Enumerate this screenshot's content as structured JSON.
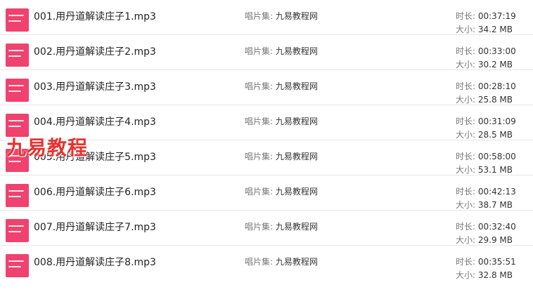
{
  "labels": {
    "album": "唱片集: ",
    "duration": "时长: ",
    "size": "大小: "
  },
  "watermark": "九易教程",
  "tracks": [
    {
      "title": "001.用丹道解读庄子1.mp3",
      "album": "九易教程网",
      "duration": "00:37:19",
      "size": "34.2 MB"
    },
    {
      "title": "002.用丹道解读庄子2.mp3",
      "album": "九易教程网",
      "duration": "00:33:00",
      "size": "30.2 MB"
    },
    {
      "title": "003.用丹道解读庄子3.mp3",
      "album": "九易教程网",
      "duration": "00:28:10",
      "size": "25.8 MB"
    },
    {
      "title": "004.用丹道解读庄子4.mp3",
      "album": "九易教程网",
      "duration": "00:31:09",
      "size": "28.5 MB"
    },
    {
      "title": "005.用丹道解读庄子5.mp3",
      "album": "九易教程网",
      "duration": "00:58:00",
      "size": "53.1 MB"
    },
    {
      "title": "006.用丹道解读庄子6.mp3",
      "album": "九易教程网",
      "duration": "00:42:13",
      "size": "38.7 MB"
    },
    {
      "title": "007.用丹道解读庄子7.mp3",
      "album": "九易教程网",
      "duration": "00:32:40",
      "size": "29.9 MB"
    },
    {
      "title": "008.用丹道解读庄子8.mp3",
      "album": "九易教程网",
      "duration": "00:35:51",
      "size": "32.8 MB"
    }
  ]
}
